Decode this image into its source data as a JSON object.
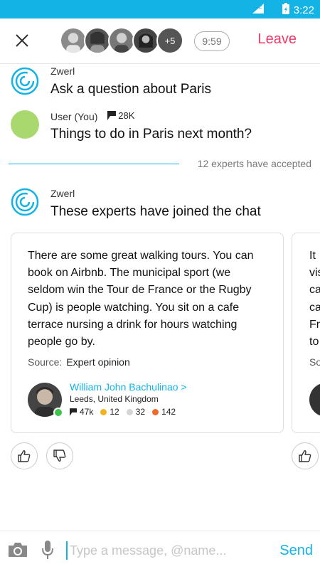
{
  "status_bar": {
    "network": "LTE",
    "time": "3:22"
  },
  "header": {
    "close_icon": "close-icon",
    "more_participants": "+5",
    "timer": "9:59",
    "leave_label": "Leave"
  },
  "messages": [
    {
      "sender": "Zwerl",
      "text": "Ask a question about Paris"
    },
    {
      "sender": "User (You)",
      "credits": "28K",
      "text": "Things to do in Paris next month?"
    },
    {
      "sender": "Zwerl",
      "text": "These experts have joined the chat"
    }
  ],
  "divider_text": "12 experts have accepted",
  "expert_card": {
    "answer": "There are some great walking tours. You can book on Airbnb. The municipal sport (we seldom win the Tour de France or the Rugby Cup) is people watching. You sit on a cafe terrace nursing a drink for hours watching people go by.",
    "source_label": "Source:",
    "source_value": "Expert opinion",
    "name": "William John Bachulinao >",
    "location": "Leeds, United Kingdom",
    "credits": "47k",
    "gold": "12",
    "silver": "32",
    "bronze": "142"
  },
  "second_card": {
    "text_fragment": "It\nvis\nca\nca\nFr\nto",
    "source_fragment": "So"
  },
  "composer": {
    "placeholder": "Type a message, @name...",
    "send_label": "Send"
  },
  "colors": {
    "accent": "#13b3e6",
    "leave": "#f0386b",
    "online": "#3ec44a",
    "user_avatar": "#a9d86e"
  }
}
